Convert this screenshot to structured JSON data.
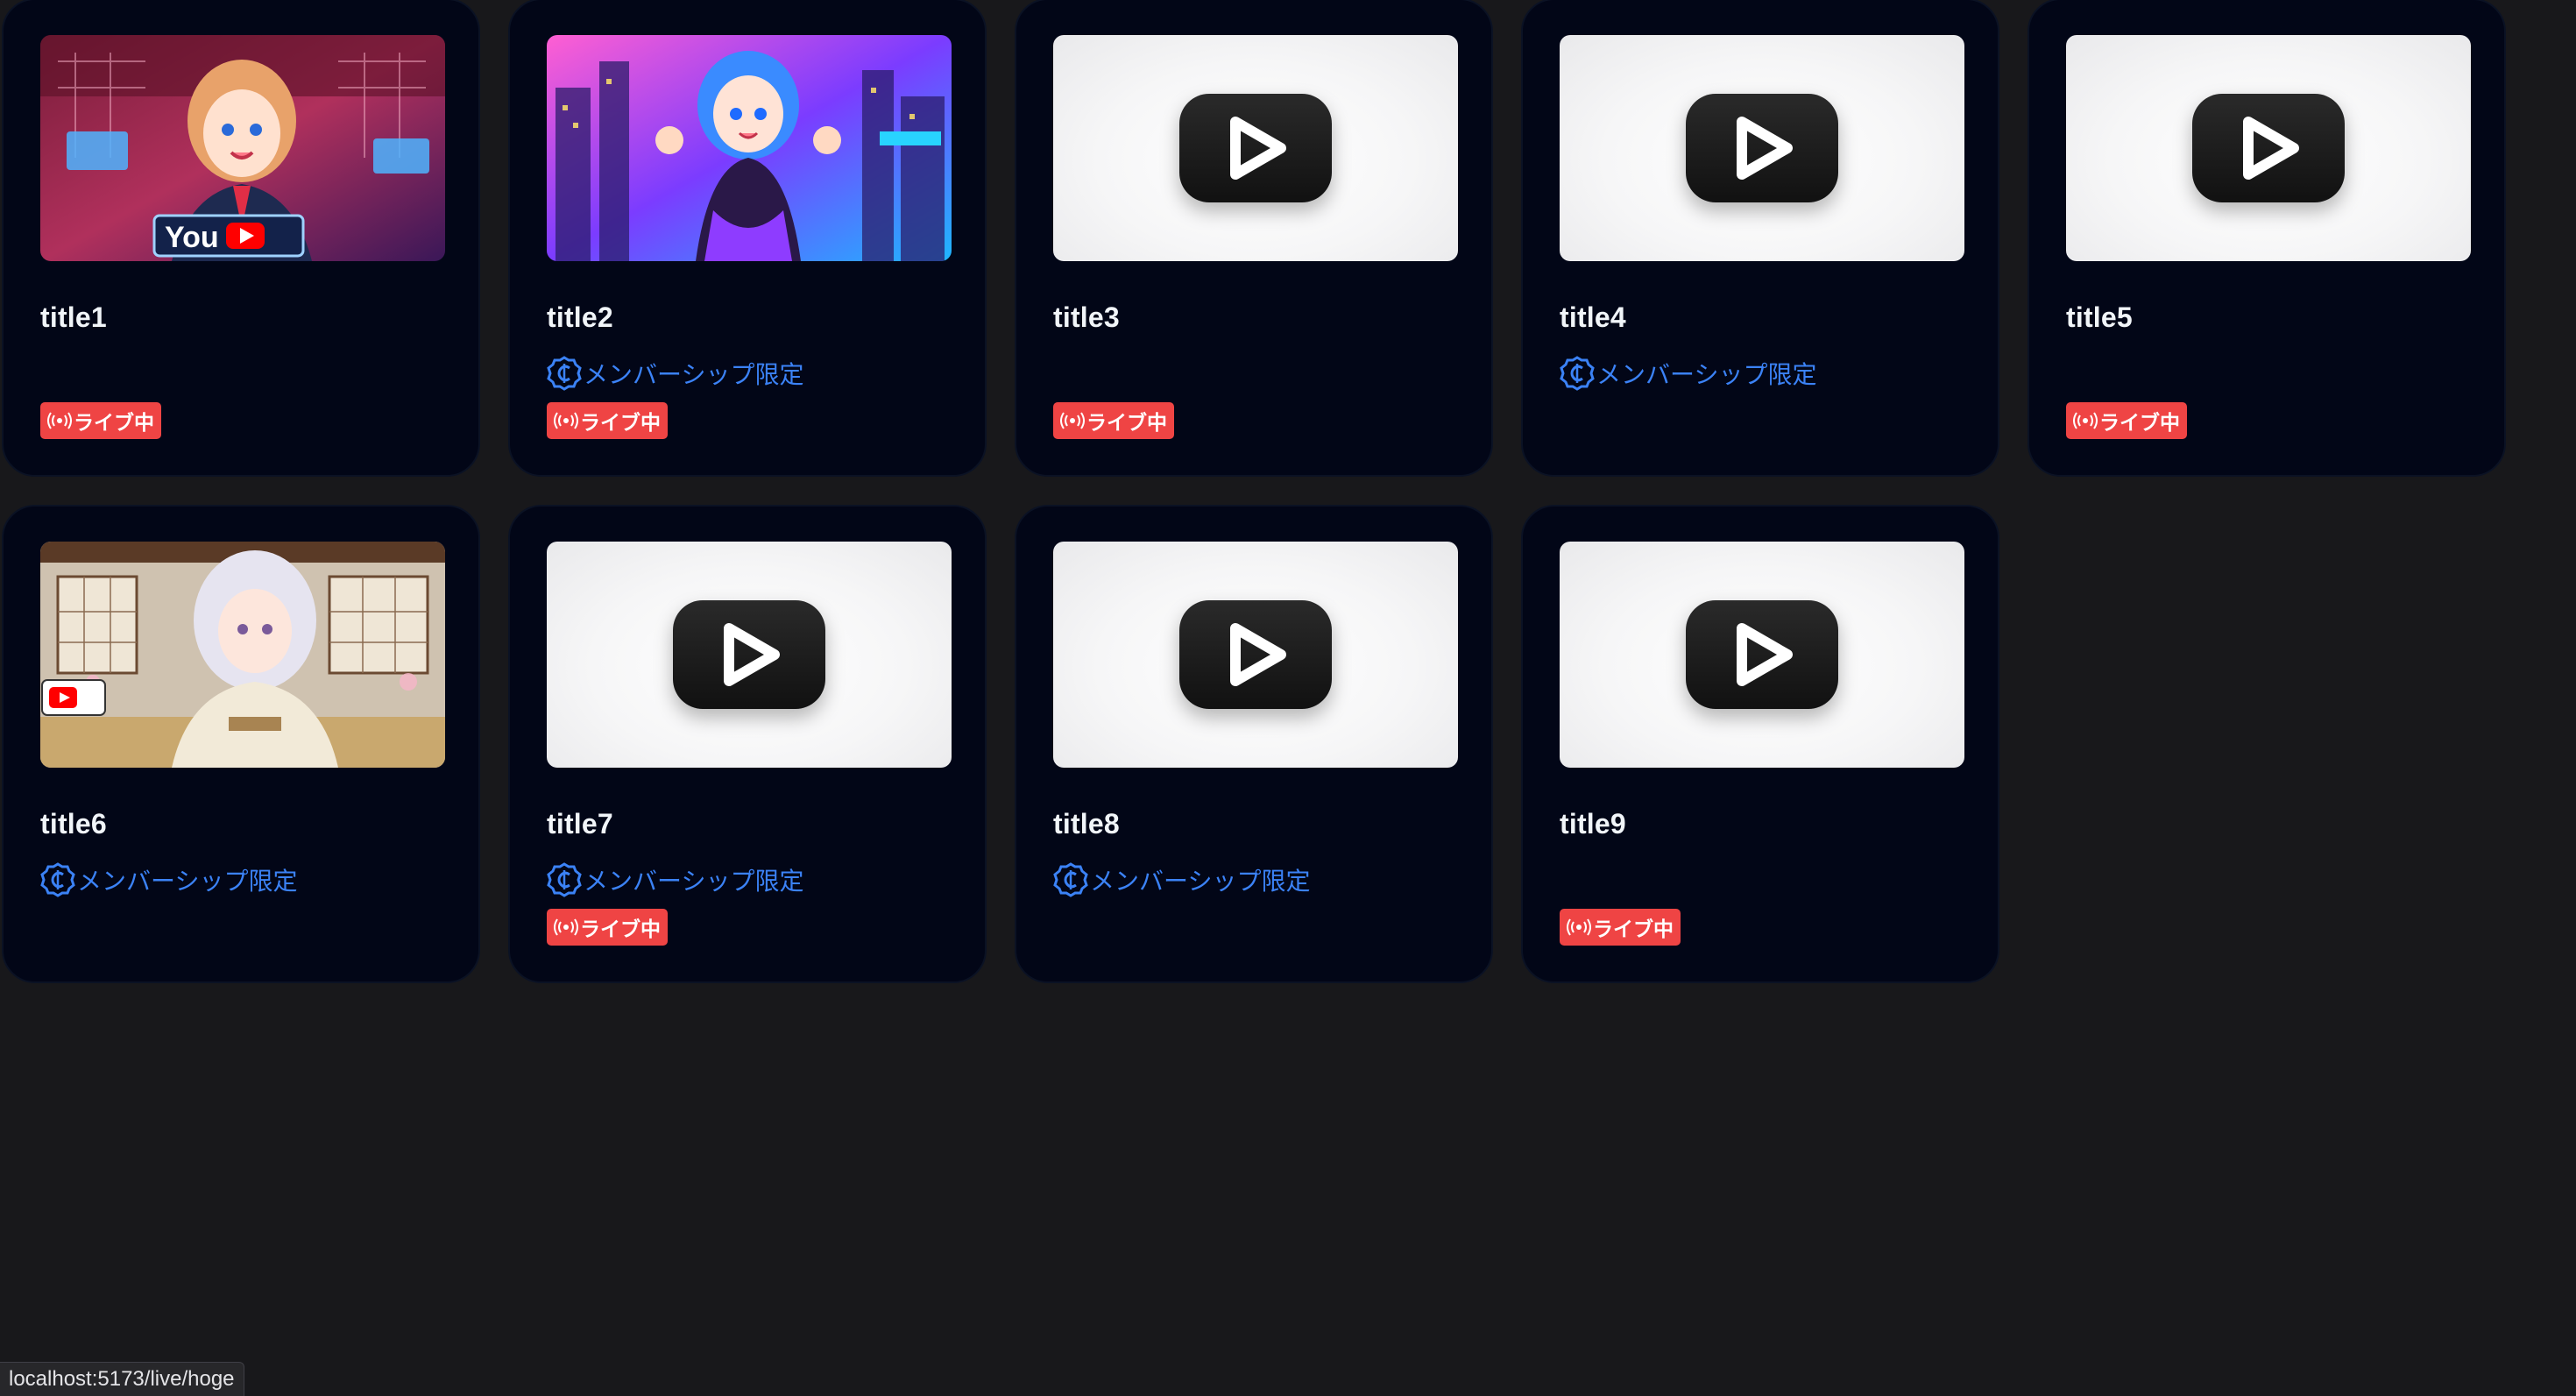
{
  "cards": [
    {
      "title": "title1",
      "thumbnail": "anime-youtuber-art",
      "member_label": "",
      "live_label": "ライブ中"
    },
    {
      "title": "title2",
      "thumbnail": "anime-neon-city-art",
      "member_label": "メンバーシップ限定",
      "live_label": "ライブ中"
    },
    {
      "title": "title3",
      "thumbnail": "play-button-placeholder",
      "member_label": "",
      "live_label": "ライブ中"
    },
    {
      "title": "title4",
      "thumbnail": "play-button-placeholder",
      "member_label": "メンバーシップ限定",
      "live_label": ""
    },
    {
      "title": "title5",
      "thumbnail": "play-button-placeholder",
      "member_label": "",
      "live_label": "ライブ中"
    },
    {
      "title": "title6",
      "thumbnail": "anime-kimono-room-art",
      "member_label": "メンバーシップ限定",
      "live_label": ""
    },
    {
      "title": "title7",
      "thumbnail": "play-button-placeholder",
      "member_label": "メンバーシップ限定",
      "live_label": "ライブ中"
    },
    {
      "title": "title8",
      "thumbnail": "play-button-placeholder",
      "member_label": "メンバーシップ限定",
      "live_label": ""
    },
    {
      "title": "title9",
      "thumbnail": "play-button-placeholder",
      "member_label": "",
      "live_label": "ライブ中"
    }
  ],
  "status_bar": {
    "url": "localhost:5173/live/hoge"
  },
  "colors": {
    "background": "#18181b",
    "card": "#020617",
    "member_accent": "#3b82f6",
    "live_badge": "#ef4444"
  }
}
